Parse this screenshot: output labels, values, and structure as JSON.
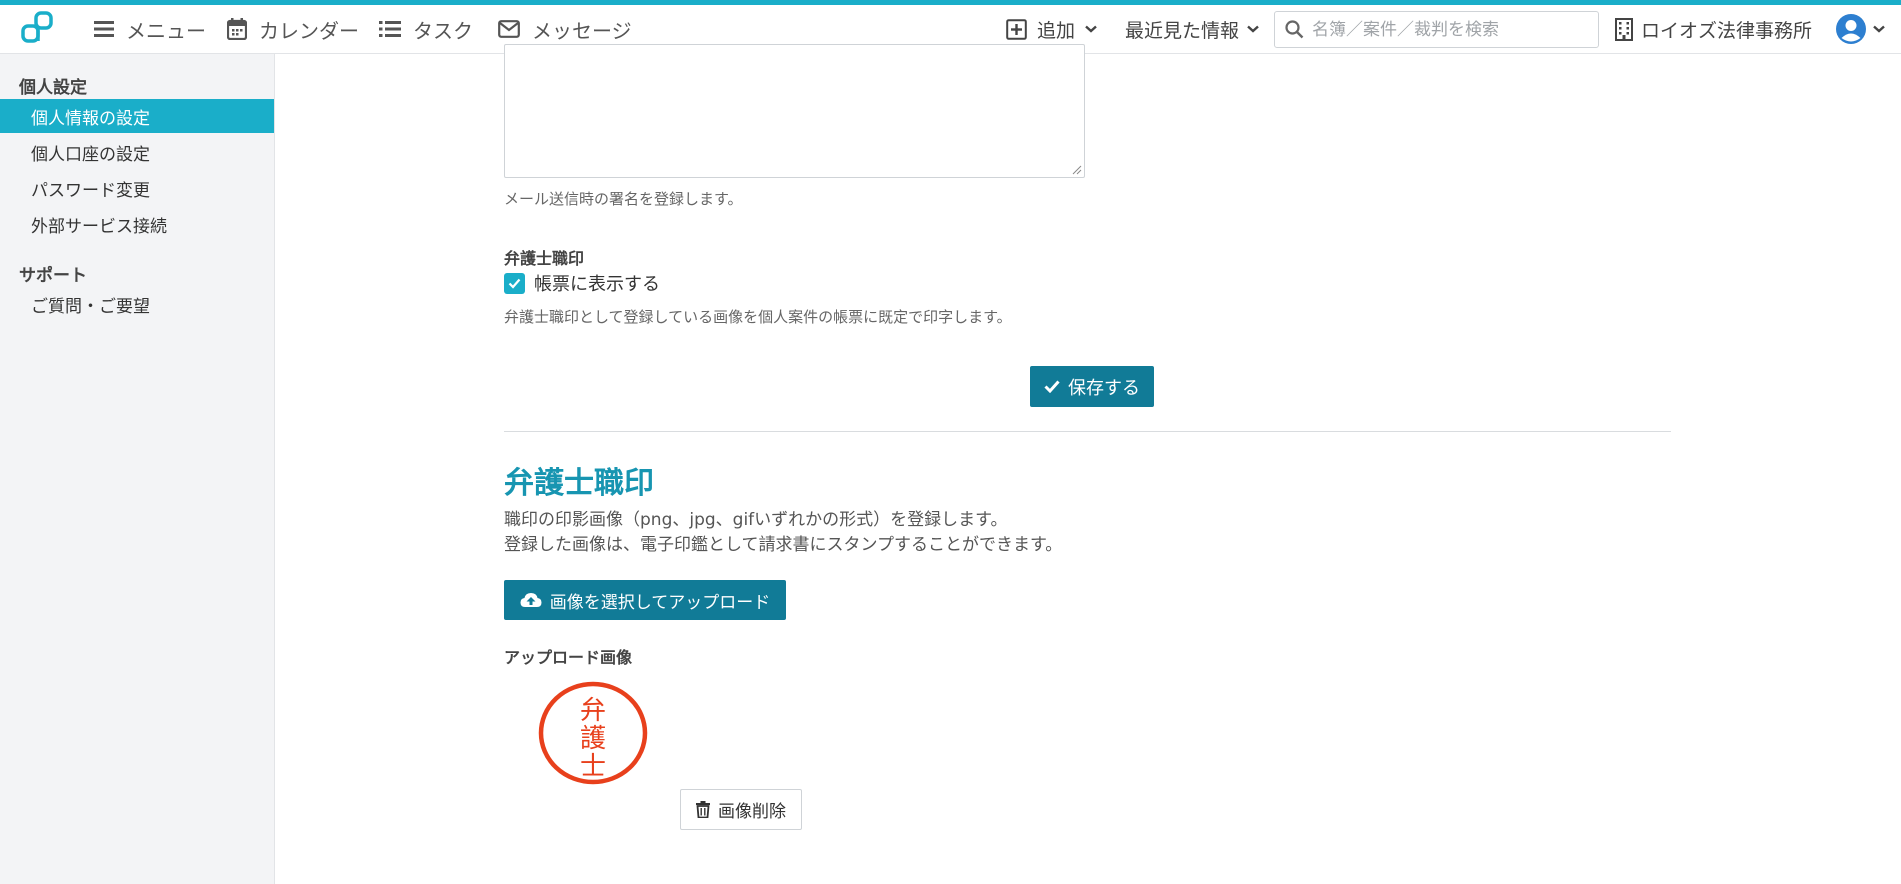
{
  "header": {
    "nav": [
      {
        "label": "メニュー",
        "icon": "hamburger-icon"
      },
      {
        "label": "カレンダー",
        "icon": "calendar-icon"
      },
      {
        "label": "タスク",
        "icon": "list-icon"
      },
      {
        "label": "メッセージ",
        "icon": "envelope-icon"
      }
    ],
    "add_label": "追加",
    "recent_label": "最近見た情報",
    "search_placeholder": "名簿／案件／裁判を検索",
    "office_name": "ロイオズ法律事務所"
  },
  "sidebar": {
    "groups": [
      {
        "heading": "個人設定",
        "items": [
          "個人情報の設定",
          "個人口座の設定",
          "パスワード変更",
          "外部サービス接続"
        ]
      },
      {
        "heading": "サポート",
        "items": [
          "ご質問・ご要望"
        ]
      }
    ],
    "active_item": "個人情報の設定"
  },
  "signature": {
    "help": "メール送信時の署名を登録します。"
  },
  "seal_option": {
    "label": "弁護士職印",
    "checkbox_label": "帳票に表示する",
    "checked": true,
    "help": "弁護士職印として登録している画像を個人案件の帳票に既定で印字します。"
  },
  "save_button": "保存する",
  "seal_section": {
    "title": "弁護士職印",
    "desc_line1": "職印の印影画像（png、jpg、gifいずれかの形式）を登録します。",
    "desc_line2": "登録した画像は、電子印鑑として請求書にスタンプすることができます。",
    "upload_button": "画像を選択してアップロード",
    "uploaded_label": "アップロード画像",
    "stamp_text": "弁護士",
    "delete_button": "画像削除"
  },
  "colors": {
    "accent": "#1aaec9",
    "button": "#117b97",
    "title": "#1795b1",
    "stamp": "#e8401c"
  }
}
